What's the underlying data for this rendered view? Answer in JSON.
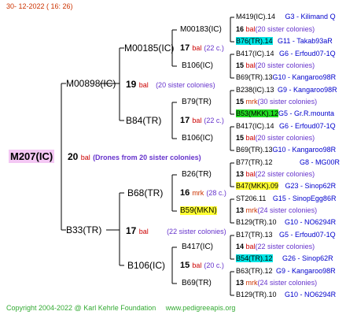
{
  "header": {
    "date": "30- 12-2022 ( 16: 26)"
  },
  "root": {
    "name": "M207(IC)",
    "num": "20",
    "bal": "bal",
    "note": "(Drones from 20 sister colonies)"
  },
  "level1": [
    {
      "name": "M00898(IC)",
      "num": "19",
      "bal": "bal",
      "note": "(20 sister colonies)"
    },
    {
      "name": "B33(TR)",
      "num": "17",
      "bal": "bal",
      "note": "(22 sister colonies)"
    }
  ],
  "level2": [
    {
      "name": "M00185(IC)",
      "num": "17",
      "bal": "bal",
      "note": "(22 c.)"
    },
    {
      "name": "B84(TR)",
      "num": "17",
      "bal": "bal",
      "note": "(22 c.)"
    },
    {
      "name": "B68(TR)",
      "num": "16",
      "bal": "mrk",
      "note": "(28 c.)"
    },
    {
      "name": "B106(IC)",
      "num": "15",
      "bal": "bal",
      "note": "(20 c.)"
    }
  ],
  "level3": [
    {
      "name": "M00183(IC)"
    },
    {
      "name": "B106(IC)"
    },
    {
      "name": "B79(TR)"
    },
    {
      "name": "B106(IC)"
    },
    {
      "name": "B26(TR)"
    },
    {
      "name": "B59(MKN)"
    },
    {
      "name": "B417(IC)"
    },
    {
      "name": "B69(TR)"
    }
  ],
  "level4": [
    {
      "name": "M419(IC).14",
      "ext": "G3 - Kilimand Q"
    },
    {
      "num": "16",
      "bal": "bal",
      "note": "(20 sister colonies)"
    },
    {
      "name": "B76(TR).14",
      "ext": "G11 - Takab93aR"
    },
    {
      "name": "B417(IC).14",
      "ext": "G6 - Erfoud07-1Q"
    },
    {
      "num": "15",
      "bal": "bal",
      "note": "(20 sister colonies)"
    },
    {
      "name": "B69(TR).13",
      "ext": "G10 - Kangaroo98R"
    },
    {
      "name": "B238(IC).13",
      "ext": "G9 - Kangaroo98R"
    },
    {
      "num": "15",
      "bal": "mrk",
      "note": "(30 sister colonies)"
    },
    {
      "name": "B53(MKK).12",
      "ext": "G5 - Gr.R.mounta"
    },
    {
      "name": "B417(IC).14",
      "ext": "G6 - Erfoud07-1Q"
    },
    {
      "num": "15",
      "bal": "bal",
      "note": "(20 sister colonies)"
    },
    {
      "name": "B69(TR).13",
      "ext": "G10 - Kangaroo98R"
    },
    {
      "name": "B77(TR).12",
      "ext": "G8 - MG00R"
    },
    {
      "num": "13",
      "bal": "bal",
      "note": "(22 sister colonies)"
    },
    {
      "name": "B47(MKK).09",
      "ext": "G23 - Sinop62R"
    },
    {
      "name": "ST206.11",
      "ext": "G15 - SinopEgg86R"
    },
    {
      "num": "13",
      "bal": "mrk",
      "note": "(24 sister colonies)"
    },
    {
      "name": "B129(TR).10",
      "ext": "G10 - NO6294R"
    },
    {
      "name": "B17(TR).13",
      "ext": "G5 - Erfoud07-1Q"
    },
    {
      "num": "14",
      "bal": "bal",
      "note": "(22 sister colonies)"
    },
    {
      "name": "B54(TR).12",
      "ext": "G26 - Sinop62R"
    },
    {
      "name": "B63(TR).12",
      "ext": "G9 - Kangaroo98R"
    },
    {
      "num": "13",
      "bal": "mrk",
      "note": "(24 sister colonies)"
    },
    {
      "name": "B129(TR).10",
      "ext": "G10 - NO6294R"
    }
  ],
  "footer": {
    "copyright": "Copyright 2004-2022 @ Karl Kehrle Foundation",
    "site": "www.pedigreeapis.org"
  }
}
